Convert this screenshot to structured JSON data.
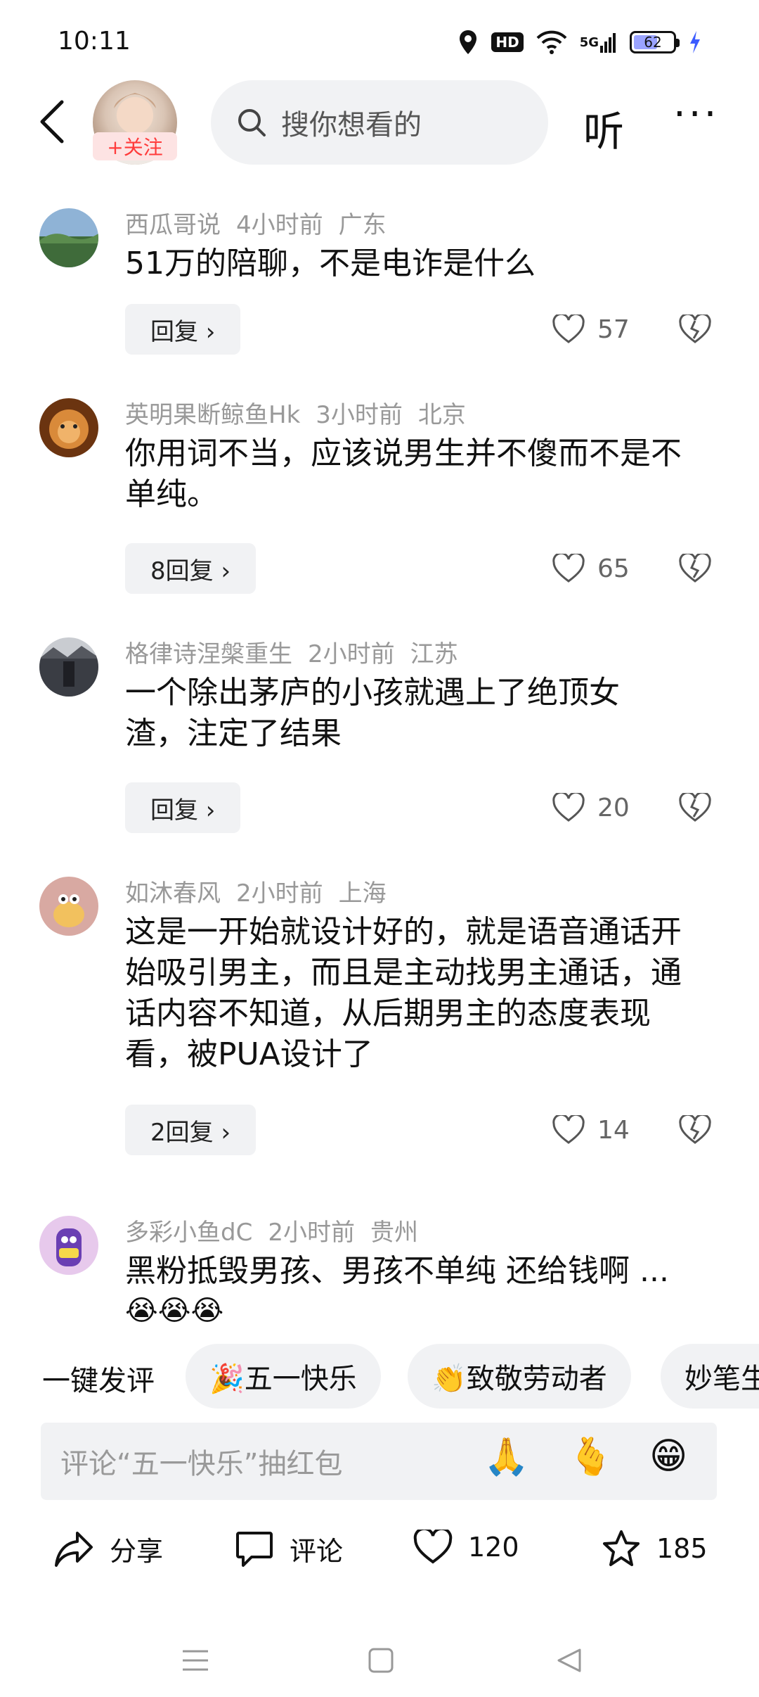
{
  "status_bar": {
    "time": "10:11",
    "hd": "HD",
    "network": "5G",
    "battery": "62",
    "battery_level": 0.62
  },
  "header": {
    "follow_label": "+关注",
    "search_placeholder": "搜你想看的",
    "listen_label": "听",
    "more_label": "···"
  },
  "comments": [
    {
      "user": "西瓜哥说",
      "time": "4小时前",
      "location": "广东",
      "text": "51万的陪聊，不是电诈是什么",
      "reply_label": "回复 ›",
      "likes": "57"
    },
    {
      "user": "英明果断鲸鱼Hk",
      "time": "3小时前",
      "location": "北京",
      "text": "你用词不当，应该说男生并不傻而不是不单纯。",
      "reply_label": "8回复 ›",
      "likes": "65"
    },
    {
      "user": "格律诗涅槃重生",
      "time": "2小时前",
      "location": "江苏",
      "text": "一个除出茅庐的小孩就遇上了绝顶女渣，注定了结果",
      "reply_label": "回复 ›",
      "likes": "20"
    },
    {
      "user": "如沐春风",
      "time": "2小时前",
      "location": "上海",
      "text": "这是一开始就设计好的，就是语音通话开始吸引男主，而且是主动找男主通话，通话内容不知道，从后期男主的态度表现看，被PUA设计了",
      "reply_label": "2回复 ›",
      "likes": "14"
    },
    {
      "user": "多彩小鱼dC",
      "time": "2小时前",
      "location": "贵州",
      "text": "黑粉抵毁男孩、男孩不单纯 还给钱啊 ...",
      "emojis": "😭😭😭"
    }
  ],
  "quick_comments": {
    "label": "一键发评",
    "chips": [
      "🎉五一快乐",
      "👏致敬劳动者",
      "妙笔生"
    ]
  },
  "comment_input": {
    "placeholder": "评论“五一快乐”抽红包",
    "emojis": [
      "🙏",
      "🫰",
      "😁"
    ]
  },
  "actions": {
    "share": "分享",
    "comment": "评论",
    "likes": "120",
    "favorites": "185"
  },
  "colors": {
    "accent_red": "#ff3b3b",
    "chip_bg": "#f1f2f4",
    "meta_gray": "#999999"
  }
}
